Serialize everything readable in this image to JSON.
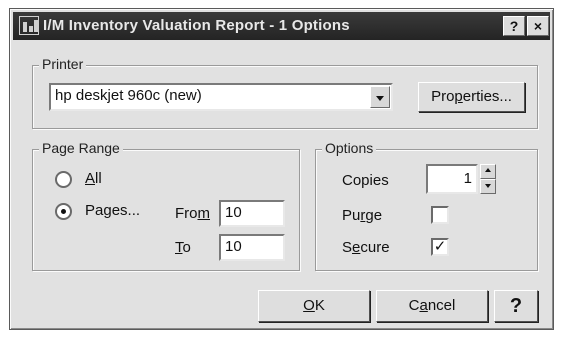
{
  "window": {
    "title": "I/M Inventory Valuation Report - 1 Options",
    "help_button": "?",
    "close_button": "×"
  },
  "printer": {
    "legend": "Printer",
    "selected": "hp deskjet 960c (new)",
    "properties_prefix": "Pro",
    "properties_accel": "p",
    "properties_suffix": "erties..."
  },
  "page_range": {
    "legend": "Page Range",
    "all_accel": "A",
    "all_rest": "ll",
    "pages_label": "Pages...",
    "selected": "pages",
    "from_prefix": "Fro",
    "from_accel": "m",
    "from_value": "10",
    "to_accel": "T",
    "to_rest": "o",
    "to_value": "10"
  },
  "options": {
    "legend": "Options",
    "copies_label": "Copies",
    "copies_value": "1",
    "purge_prefix": "Pu",
    "purge_accel": "r",
    "purge_suffix": "ge",
    "purge_checked": false,
    "secure_prefix": "S",
    "secure_accel": "e",
    "secure_suffix": "cure",
    "secure_checked": true,
    "check_mark": "✓"
  },
  "footer": {
    "ok_accel": "O",
    "ok_rest": "K",
    "cancel_prefix": "C",
    "cancel_accel": "a",
    "cancel_suffix": "ncel",
    "help_label": "?"
  }
}
